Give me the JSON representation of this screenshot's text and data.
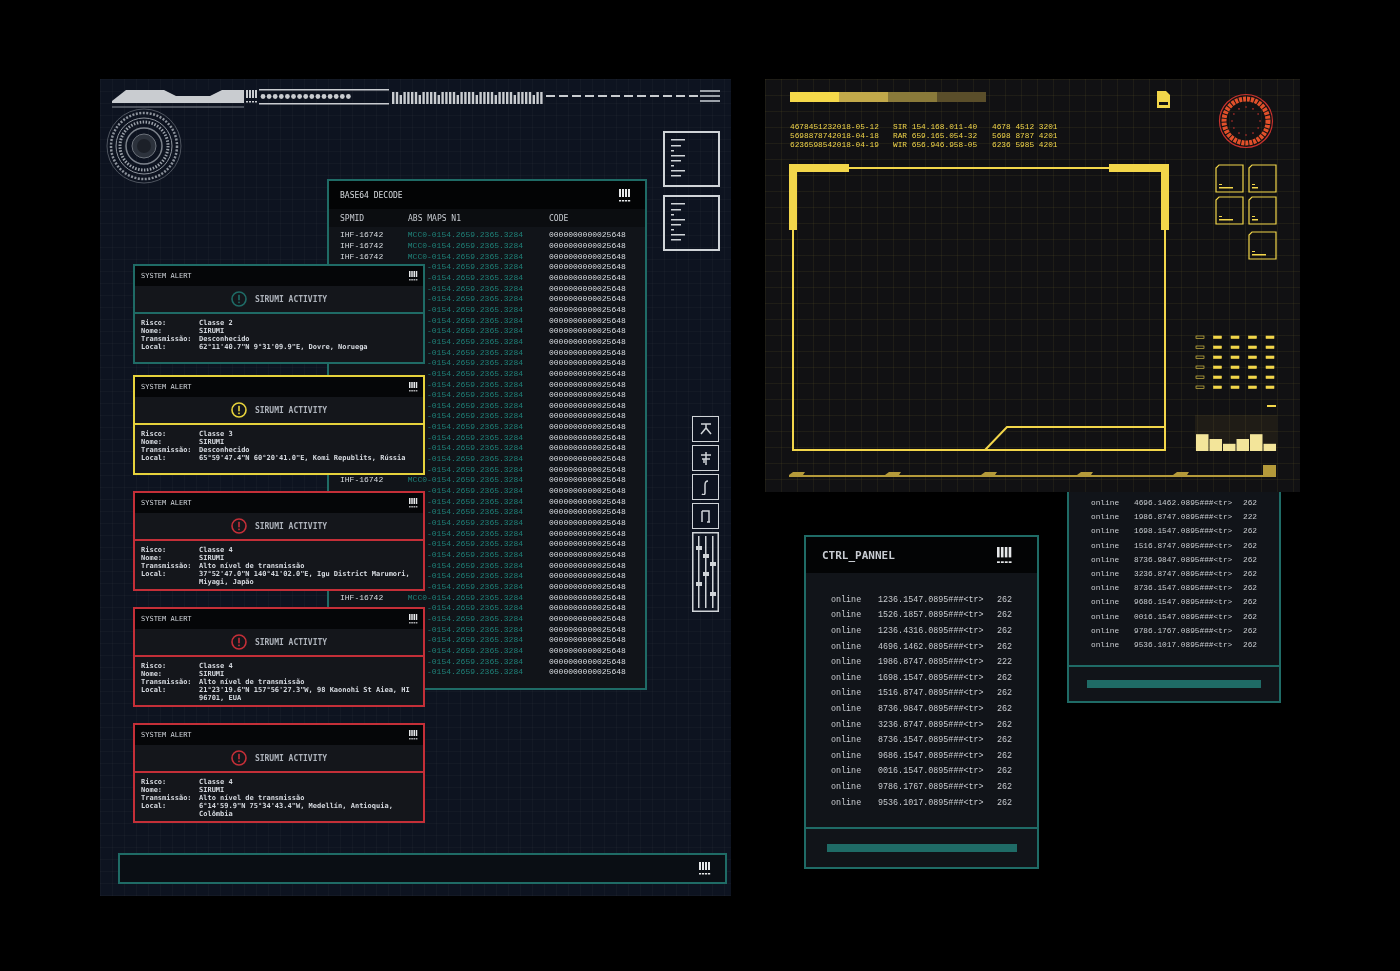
{
  "decode_table": {
    "title": "BASE64 DECODE",
    "columns": [
      "SPMID",
      "ABS MAPS N1",
      "CODE"
    ],
    "rows": [
      {
        "spmid": "IHF-16742",
        "maps": "MCC0-0154.2659.2365.3284",
        "code": "0000000000025648"
      },
      {
        "spmid": "IHF-16742",
        "maps": "MCC0-0154.2659.2365.3284",
        "code": "0000000000025648"
      },
      {
        "spmid": "IHF-16742",
        "maps": "MCC0-0154.2659.2365.3284",
        "code": "0000000000025648"
      },
      {
        "maps": "-0154.2659.2365.3284",
        "code": "0000000000025648"
      },
      {
        "maps": "-0154.2659.2365.3284",
        "code": "0000000000025648"
      },
      {
        "maps": "-0154.2659.2365.3284",
        "code": "0000000000025648"
      },
      {
        "maps": "-0154.2659.2365.3284",
        "code": "0000000000025648"
      },
      {
        "maps": "-0154.2659.2365.3284",
        "code": "0000000000025648"
      },
      {
        "maps": "-0154.2659.2365.3284",
        "code": "0000000000025648"
      },
      {
        "maps": "-0154.2659.2365.3284",
        "code": "0000000000025648"
      },
      {
        "maps": "-0154.2659.2365.3284",
        "code": "0000000000025648"
      },
      {
        "maps": "-0154.2659.2365.3284",
        "code": "0000000000025648"
      },
      {
        "maps": "-0154.2659.2365.3284",
        "code": "0000000000025648"
      },
      {
        "maps": "-0154.2659.2365.3284",
        "code": "0000000000025648"
      },
      {
        "maps": "-0154.2659.2365.3284",
        "code": "0000000000025648"
      },
      {
        "maps": "-0154.2659.2365.3284",
        "code": "0000000000025648"
      },
      {
        "maps": "-0154.2659.2365.3284",
        "code": "0000000000025648"
      },
      {
        "maps": "-0154.2659.2365.3284",
        "code": "0000000000025648"
      },
      {
        "maps": "-0154.2659.2365.3284",
        "code": "0000000000025648"
      },
      {
        "maps": "-0154.2659.2365.3284",
        "code": "0000000000025648"
      },
      {
        "maps": "-0154.2659.2365.3284",
        "code": "0000000000025648"
      },
      {
        "maps": "-0154.2659.2365.3284",
        "code": "0000000000025648"
      },
      {
        "maps": "-0154.2659.2365.3284",
        "code": "0000000000025648"
      },
      {
        "spmid": "IHF-16742",
        "maps": "MCC0-0154.2659.2365.3284",
        "code": "0000000000025648"
      },
      {
        "maps": "-0154.2659.2365.3284",
        "code": "0000000000025648"
      },
      {
        "maps": "-0154.2659.2365.3284",
        "code": "0000000000025648"
      },
      {
        "maps": "-0154.2659.2365.3284",
        "code": "0000000000025648"
      },
      {
        "maps": "-0154.2659.2365.3284",
        "code": "0000000000025648"
      },
      {
        "maps": "-0154.2659.2365.3284",
        "code": "0000000000025648"
      },
      {
        "maps": "-0154.2659.2365.3284",
        "code": "0000000000025648"
      },
      {
        "maps": "-0154.2659.2365.3284",
        "code": "0000000000025648"
      },
      {
        "maps": "-0154.2659.2365.3284",
        "code": "0000000000025648"
      },
      {
        "maps": "-0154.2659.2365.3284",
        "code": "0000000000025648"
      },
      {
        "maps": "-0154.2659.2365.3284",
        "code": "0000000000025648"
      },
      {
        "spmid": "IHF-16742",
        "maps": "MCC0-0154.2659.2365.3284",
        "code": "0000000000025648"
      },
      {
        "maps": "-0154.2659.2365.3284",
        "code": "0000000000025648"
      },
      {
        "maps": "-0154.2659.2365.3284",
        "code": "0000000000025648"
      },
      {
        "maps": "-0154.2659.2365.3284",
        "code": "0000000000025648"
      },
      {
        "maps": "-0154.2659.2365.3284",
        "code": "0000000000025648"
      },
      {
        "maps": "-0154.2659.2365.3284",
        "code": "0000000000025648"
      },
      {
        "maps": "-0154.2659.2365.3284",
        "code": "0000000000025648"
      },
      {
        "maps": "-0154.2659.2365.3284",
        "code": "0000000000025648"
      }
    ]
  },
  "alerts": [
    {
      "title": "SYSTEM ALERT",
      "color": "#1f6b66",
      "heading": "SIRUMI ACTIVITY",
      "details": [
        {
          "label": "Risco:",
          "value": "Classe 2"
        },
        {
          "label": "Nome:",
          "value": "SIRUMI"
        },
        {
          "label": "Transmissão:",
          "value": "Desconhecido"
        },
        {
          "label": "Local:",
          "value": "62°11'40.7\"N 9°31'09.9\"E, Dovre, Noruega"
        }
      ]
    },
    {
      "title": "SYSTEM ALERT",
      "color": "#e6d23c",
      "heading": "SIRUMI ACTIVITY",
      "details": [
        {
          "label": "Risco:",
          "value": "Classe 3"
        },
        {
          "label": "Nome:",
          "value": "SIRUMI"
        },
        {
          "label": "Transmissão:",
          "value": "Desconhecido"
        },
        {
          "label": "Local:",
          "value": "65°59'47.4\"N 60°20'41.0\"E, Komi Republits, Rússia"
        }
      ]
    },
    {
      "title": "SYSTEM ALERT",
      "color": "#c42f38",
      "heading": "SIRUMI ACTIVITY",
      "details": [
        {
          "label": "Risco:",
          "value": "Classe 4"
        },
        {
          "label": "Nome:",
          "value": "SIRUMI"
        },
        {
          "label": "Transmissão:",
          "value": "Alto nível de transmissão"
        },
        {
          "label": "Local:",
          "value": "37°52'47.0\"N 140°41'02.0\"E, Igu District Marumori, Miyagi, Japão"
        }
      ]
    },
    {
      "title": "SYSTEM ALERT",
      "color": "#c42f38",
      "heading": "SIRUMI ACTIVITY",
      "details": [
        {
          "label": "Risco:",
          "value": "Classe 4"
        },
        {
          "label": "Nome:",
          "value": "SIRUMI"
        },
        {
          "label": "Transmissão:",
          "value": "Alto nível de transmissão"
        },
        {
          "label": "Local:",
          "value": "21°23'19.6\"N 157°56'27.3\"W, 98 Kaonohi St Aiea, HI 96701, EUA"
        }
      ]
    },
    {
      "title": "SYSTEM ALERT",
      "color": "#c42f38",
      "heading": "SIRUMI ACTIVITY",
      "details": [
        {
          "label": "Risco:",
          "value": "Classe 4"
        },
        {
          "label": "Nome:",
          "value": "SIRUMI"
        },
        {
          "label": "Transmissão:",
          "value": "Alto nível de transmissão"
        },
        {
          "label": "Local:",
          "value": "6°14'59.9\"N 75°34'43.4\"W, Medellín, Antioquia, Colômbia"
        }
      ]
    }
  ],
  "hud": {
    "readouts": [
      [
        "4678451232018-05-12",
        "SIR 154.168.011-40",
        "4678 4512 3201"
      ],
      [
        "5698878742018-04-18",
        "RAR 659.165.054-32",
        "5698 8787 4201"
      ],
      [
        "6236598542018-04-19",
        "WIR 656.946.958-05",
        "6236 5985 4201"
      ]
    ]
  },
  "status_list": {
    "rows": [
      {
        "status": "online",
        "value": "4696.1462.0895###<tr>",
        "count": "262"
      },
      {
        "status": "online",
        "value": "1986.8747.0895###<tr>",
        "count": "222"
      },
      {
        "status": "online",
        "value": "1698.1547.0895###<tr>",
        "count": "262"
      },
      {
        "status": "online",
        "value": "1516.8747.0895###<tr>",
        "count": "262"
      },
      {
        "status": "online",
        "value": "8736.9847.0895###<tr>",
        "count": "262"
      },
      {
        "status": "online",
        "value": "3236.8747.0895###<tr>",
        "count": "262"
      },
      {
        "status": "online",
        "value": "8736.1547.0895###<tr>",
        "count": "262"
      },
      {
        "status": "online",
        "value": "9686.1547.0895###<tr>",
        "count": "262"
      },
      {
        "status": "online",
        "value": "0016.1547.0895###<tr>",
        "count": "262"
      },
      {
        "status": "online",
        "value": "9786.1767.0895###<tr>",
        "count": "262"
      },
      {
        "status": "online",
        "value": "9536.1017.0895###<tr>",
        "count": "262"
      }
    ]
  },
  "ctrl_panel": {
    "title": "CTRL_PANNEL",
    "rows": [
      {
        "status": "online",
        "value": "1236.1547.0895###<tr>",
        "count": "262"
      },
      {
        "status": "online",
        "value": "1526.1857.0895###<tr>",
        "count": "262"
      },
      {
        "status": "online",
        "value": "1236.4316.0895###<tr>",
        "count": "262"
      },
      {
        "status": "online",
        "value": "4696.1462.0895###<tr>",
        "count": "262"
      },
      {
        "status": "online",
        "value": "1986.8747.0895###<tr>",
        "count": "222"
      },
      {
        "status": "online",
        "value": "1698.1547.0895###<tr>",
        "count": "262"
      },
      {
        "status": "online",
        "value": "1516.8747.0895###<tr>",
        "count": "262"
      },
      {
        "status": "online",
        "value": "8736.9847.0895###<tr>",
        "count": "262"
      },
      {
        "status": "online",
        "value": "3236.8747.0895###<tr>",
        "count": "262"
      },
      {
        "status": "online",
        "value": "8736.1547.0895###<tr>",
        "count": "262"
      },
      {
        "status": "online",
        "value": "9686.1547.0895###<tr>",
        "count": "262"
      },
      {
        "status": "online",
        "value": "0016.1547.0895###<tr>",
        "count": "262"
      },
      {
        "status": "online",
        "value": "9786.1767.0895###<tr>",
        "count": "262"
      },
      {
        "status": "online",
        "value": "9536.1017.0895###<tr>",
        "count": "262"
      }
    ]
  }
}
